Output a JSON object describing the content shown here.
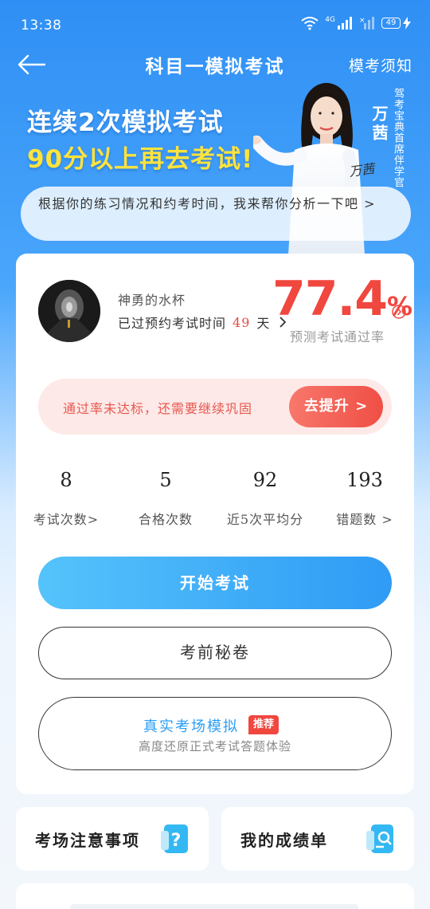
{
  "status_bar": {
    "time": "13:38",
    "network": "4G",
    "battery": "49"
  },
  "nav": {
    "title": "科目一模拟考试",
    "right_link": "模考须知"
  },
  "banner": {
    "line1": "连续2次模拟考试",
    "line2": "90分以上再去考试!",
    "presenter_name": "万茜",
    "presenter_title": "驾考宝典首席伴学官",
    "signature": "万茜",
    "speech": "根据你的练习情况和约考时间，我来帮你分析一下吧 >"
  },
  "profile": {
    "user_name": "神勇的水杯",
    "days_prefix": "已过预约考试时间",
    "days_value": "49",
    "days_suffix": "天",
    "pass_rate": "77.4",
    "pass_rate_unit": "%",
    "pass_rate_label": "预测考试通过率"
  },
  "tip": {
    "text": "通过率未达标，还需要继续巩固",
    "button": "去提升 >"
  },
  "stats": [
    {
      "value": "8",
      "label": "考试次数>"
    },
    {
      "value": "5",
      "label": "合格次数"
    },
    {
      "value": "92",
      "label": "近5次平均分"
    },
    {
      "value": "193",
      "label": "错题数 >"
    }
  ],
  "actions": {
    "start": "开始考试",
    "secret": "考前秘卷",
    "real_title": "真实考场模拟",
    "real_badge": "推荐",
    "real_sub": "高度还原正式考试答题体验"
  },
  "tiles": {
    "notice": "考场注意事项",
    "scores": "我的成绩单"
  },
  "colors": {
    "accent_red": "#f0473f",
    "accent_blue": "#2f9bf5",
    "banner_yellow": "#ffe33d"
  },
  "icons": [
    "back-arrow-icon",
    "wifi-icon",
    "signal-icon",
    "battery-icon",
    "chevron-right-icon",
    "question-doc-icon",
    "search-doc-icon"
  ]
}
